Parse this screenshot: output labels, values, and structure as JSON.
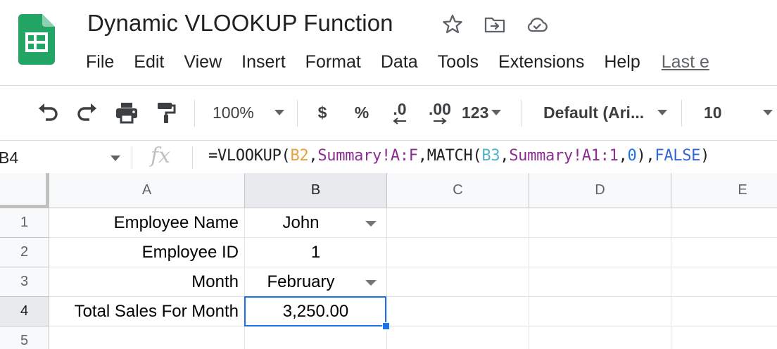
{
  "app": {
    "logo_icon": "google-sheets-logo",
    "accent_color": "#1a73e8",
    "logo_color": "#23a566"
  },
  "title": {
    "text": "Dynamic VLOOKUP Function",
    "icons": [
      "star-icon",
      "move-folder-icon",
      "cloud-saved-icon"
    ]
  },
  "menu": {
    "items": [
      "File",
      "Edit",
      "View",
      "Insert",
      "Format",
      "Data",
      "Tools",
      "Extensions",
      "Help"
    ],
    "last_edit": "Last e"
  },
  "toolbar": {
    "zoom": "100%",
    "currency": "$",
    "percent": "%",
    "decrease_decimal": ".0",
    "increase_decimal": ".00",
    "more_formats": "123",
    "font": "Default (Ari...",
    "font_size": "10",
    "icons": [
      "undo-icon",
      "redo-icon",
      "print-icon",
      "paint-format-icon"
    ]
  },
  "formula_bar": {
    "name_box": "B4",
    "fx": "fx",
    "formula": "=VLOOKUP(B2,Summary!A:F,MATCH(B3,Summary!A1:1,0),FALSE)",
    "tokens": [
      {
        "text": "=VLOOKUP(",
        "role": "plain"
      },
      {
        "text": "B2",
        "role": "ref1"
      },
      {
        "text": ",",
        "role": "plain"
      },
      {
        "text": "Summary!A:F",
        "role": "sheet"
      },
      {
        "text": ",MATCH(",
        "role": "plain"
      },
      {
        "text": "B3",
        "role": "ref2"
      },
      {
        "text": ",",
        "role": "plain"
      },
      {
        "text": "Summary!A1:1",
        "role": "sheet"
      },
      {
        "text": ",",
        "role": "plain"
      },
      {
        "text": "0",
        "role": "num"
      },
      {
        "text": "),",
        "role": "plain"
      },
      {
        "text": "FALSE",
        "role": "bool"
      },
      {
        "text": ")",
        "role": "plain"
      }
    ]
  },
  "grid": {
    "columns": [
      "A",
      "B",
      "C",
      "D",
      "E"
    ],
    "active_column": "B",
    "rows": [
      "1",
      "2",
      "3",
      "4",
      "5"
    ],
    "active_row": "4",
    "cells": {
      "A1": "Employee Name",
      "B1": "John",
      "A2": "Employee ID",
      "B2": "1",
      "A3": "Month",
      "B3": "February",
      "A4": "Total Sales For Month",
      "B4": "3,250.00"
    },
    "dropdown_cells": [
      "B1",
      "B3"
    ],
    "selected_cell": "B4"
  }
}
